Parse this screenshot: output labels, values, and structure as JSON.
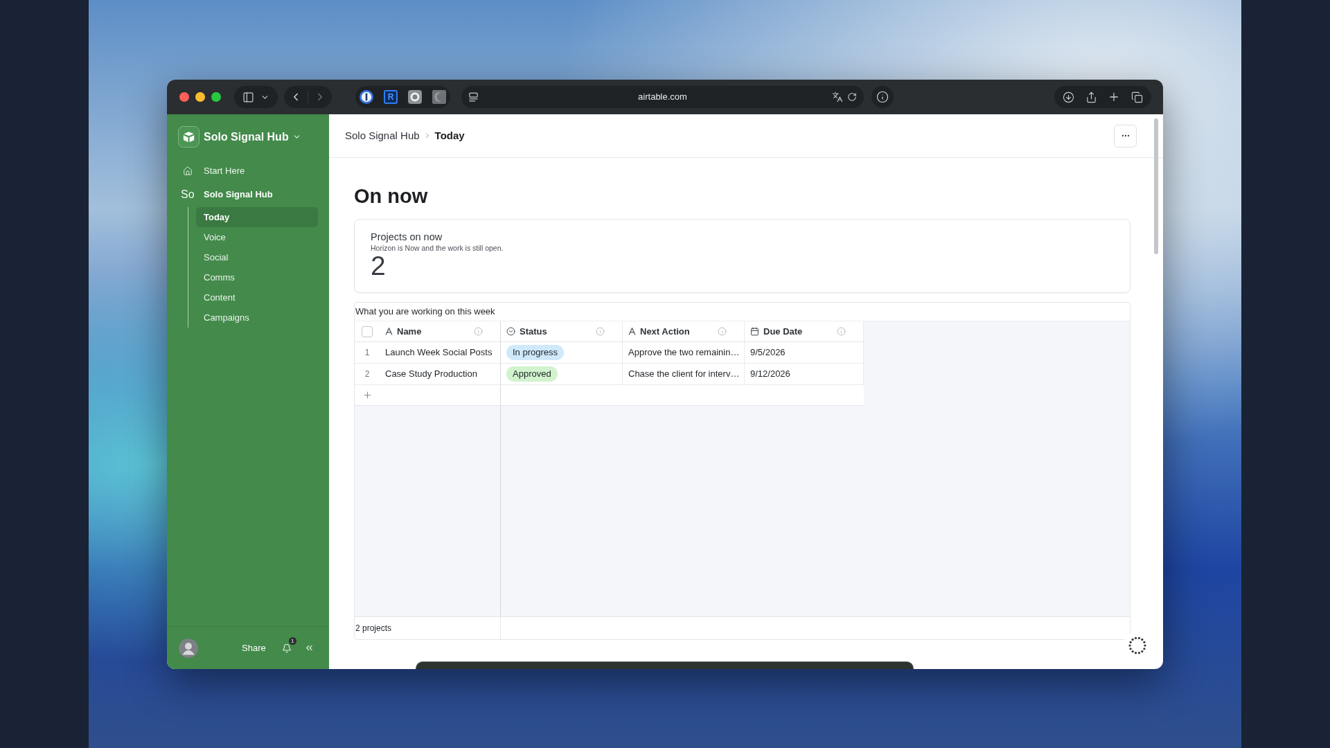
{
  "browser": {
    "navigation": {
      "back_enabled": true,
      "forward_enabled": false
    },
    "extensions": [
      {
        "kind": "keyhole"
      },
      {
        "kind": "letter",
        "text": "R"
      },
      {
        "kind": "disc"
      },
      {
        "kind": "crescent"
      }
    ],
    "url": "airtable.com"
  },
  "sidebar": {
    "workspace": "Solo Signal Hub",
    "items": [
      {
        "kind": "home",
        "label": "Start Here"
      },
      {
        "kind": "base",
        "abbr": "So",
        "label": "Solo Signal Hub",
        "children": [
          {
            "label": "Today",
            "selected": true
          },
          {
            "label": "Voice",
            "selected": false
          },
          {
            "label": "Social",
            "selected": false
          },
          {
            "label": "Comms",
            "selected": false
          },
          {
            "label": "Content",
            "selected": false
          },
          {
            "label": "Campaigns",
            "selected": false
          }
        ]
      }
    ],
    "share": "Share",
    "notification_count": "1"
  },
  "breadcrumb": [
    "Solo Signal Hub",
    "Today"
  ],
  "page_title": "On now",
  "metric": {
    "title": "Projects on now",
    "subtitle": "Horizon is Now and the work is still open.",
    "value": "2"
  },
  "table": {
    "title": "What you are working on this week",
    "header_checkbox": {
      "checked": false
    },
    "columns": [
      {
        "label": "Name",
        "kind": "text"
      },
      {
        "label": "Status",
        "kind": "select"
      },
      {
        "label": "Next Action",
        "kind": "text"
      },
      {
        "label": "Due Date",
        "kind": "date"
      }
    ],
    "rows": [
      {
        "number": "1",
        "cells": [
          {
            "kind": "text",
            "text": "Launch Week Social Posts"
          },
          {
            "kind": "tag",
            "text": "In progress",
            "color": "#cfe9fb"
          },
          {
            "kind": "text",
            "text": "Approve the two remainin…"
          },
          {
            "kind": "text",
            "text": "9/5/2026"
          }
        ]
      },
      {
        "number": "2",
        "cells": [
          {
            "kind": "text",
            "text": "Case Study Production"
          },
          {
            "kind": "tag",
            "text": "Approved",
            "color": "#d1f3cd"
          },
          {
            "kind": "text",
            "text": "Chase the client for interv…"
          },
          {
            "kind": "text",
            "text": "9/12/2026"
          }
        ]
      }
    ],
    "footer": "2 projects"
  }
}
